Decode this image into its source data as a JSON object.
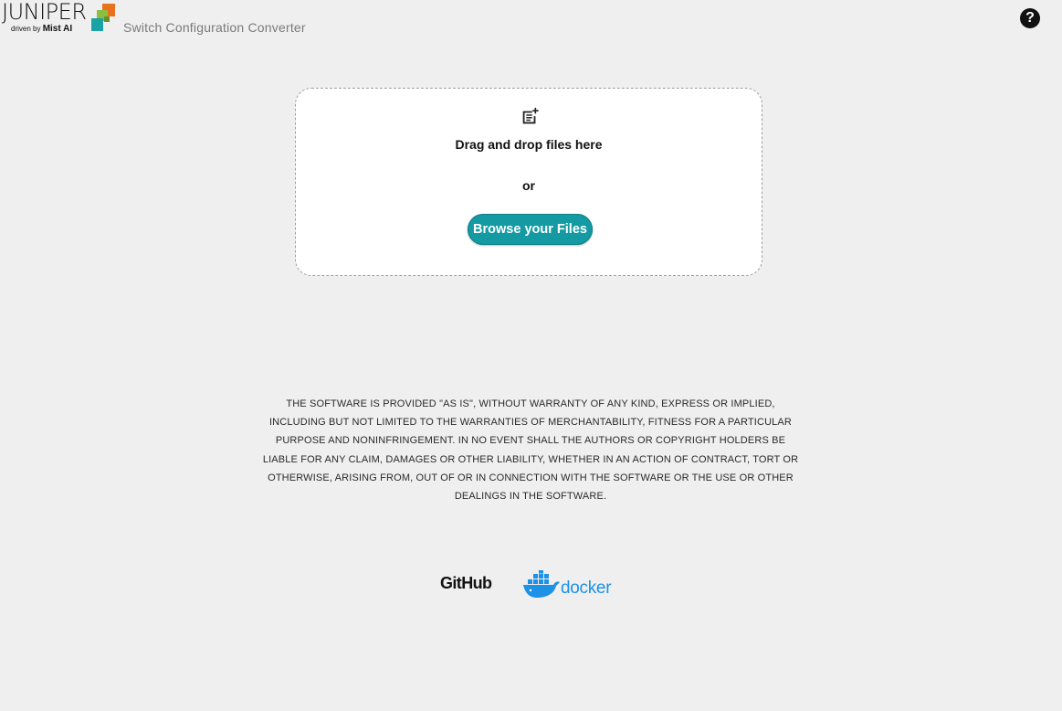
{
  "header": {
    "logo_word": "JUNIPER",
    "logo_tag_prefix": "driven by",
    "logo_tag_brand": "Mist AI",
    "app_title": "Switch Configuration Converter",
    "help_label": "?"
  },
  "dropzone": {
    "icon": "note-add-icon",
    "drop_label": "Drag and drop files here",
    "or_label": "or",
    "browse_label": "Browse your Files",
    "accent_color": "#139aa3"
  },
  "license": {
    "text": "THE SOFTWARE IS PROVIDED \"AS IS\", WITHOUT WARRANTY OF ANY KIND, EXPRESS OR IMPLIED, INCLUDING BUT NOT LIMITED TO THE WARRANTIES OF MERCHANTABILITY, FITNESS FOR A PARTICULAR PURPOSE AND NONINFRINGEMENT. IN NO EVENT SHALL THE AUTHORS OR COPYRIGHT HOLDERS BE LIABLE FOR ANY CLAIM, DAMAGES OR OTHER LIABILITY, WHETHER IN AN ACTION OF CONTRACT, TORT OR OTHERWISE, ARISING FROM, OUT OF OR IN CONNECTION WITH THE SOFTWARE OR THE USE OR OTHER DEALINGS IN THE SOFTWARE."
  },
  "footer": {
    "github_label": "GitHub",
    "docker_label": "docker",
    "docker_color": "#1d91e6"
  }
}
